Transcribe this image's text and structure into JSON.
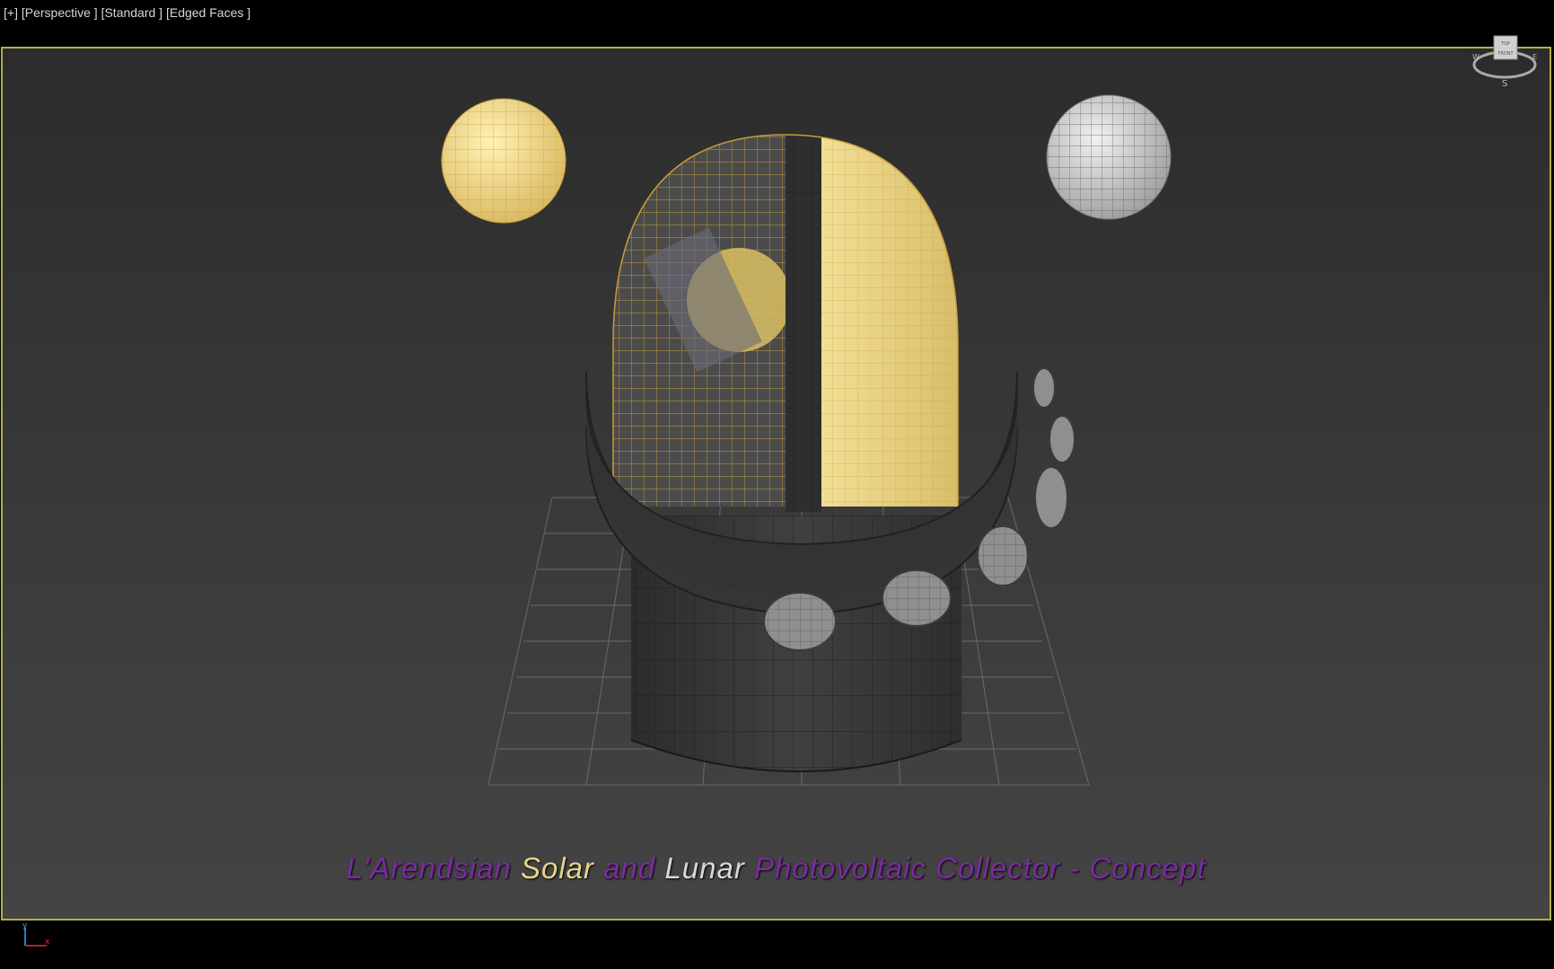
{
  "viewport": {
    "menu_plus": "[+]",
    "menu_view": "[Perspective ]",
    "menu_shading": "[Standard ]",
    "menu_edges": "[Edged Faces ]"
  },
  "caption": {
    "part1": "L'Arendsian",
    "part2": "Solar",
    "part3": "and",
    "part4": "Lunar",
    "part5": "Photovoltaic Collector - Concept",
    "color_purple": "#7a2c9e",
    "color_gold": "#e8d589",
    "color_silver": "#d8d8d8"
  },
  "viewcube": {
    "face_top": "TOP",
    "face_front": "FRONT",
    "compass_w": "W",
    "compass_e": "E",
    "compass_s": "S"
  },
  "axis": {
    "x_label": "x",
    "y_label": "y"
  },
  "colors": {
    "viewport_border": "#b3b046",
    "sun_yellow": "#f0dc8c",
    "moon_gray": "#d4d4d4",
    "body_dark": "#3b3b3b"
  }
}
